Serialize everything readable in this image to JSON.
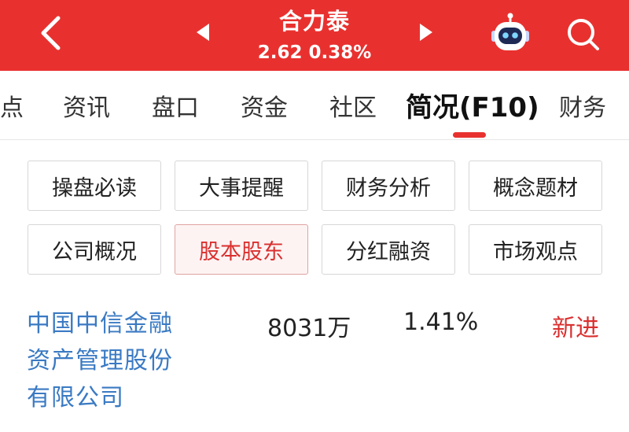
{
  "header": {
    "stock_name": "合力泰",
    "quote": "2.62 0.38%",
    "background_color": "#e8312f"
  },
  "tabs": [
    {
      "label": "点"
    },
    {
      "label": "资讯"
    },
    {
      "label": "盘口"
    },
    {
      "label": "资金"
    },
    {
      "label": "社区"
    },
    {
      "label": "简况(F10)",
      "active": true
    },
    {
      "label": "财务"
    }
  ],
  "sub_menu": [
    {
      "label": "操盘必读"
    },
    {
      "label": "大事提醒"
    },
    {
      "label": "财务分析"
    },
    {
      "label": "概念题材"
    },
    {
      "label": "公司概况"
    },
    {
      "label": "股本股东",
      "selected": true
    },
    {
      "label": "分红融资"
    },
    {
      "label": "市场观点"
    }
  ],
  "shareholder_row": {
    "name_lines": [
      "中国中信金融",
      "资产管理股份",
      "有限公司"
    ],
    "shares": "8031万",
    "ratio": "1.41%",
    "change": "新进"
  },
  "icons": {
    "back": "chevron-left-icon",
    "prev": "triangle-left-icon",
    "next": "triangle-right-icon",
    "assistant": "robot-icon",
    "search": "search-icon"
  }
}
